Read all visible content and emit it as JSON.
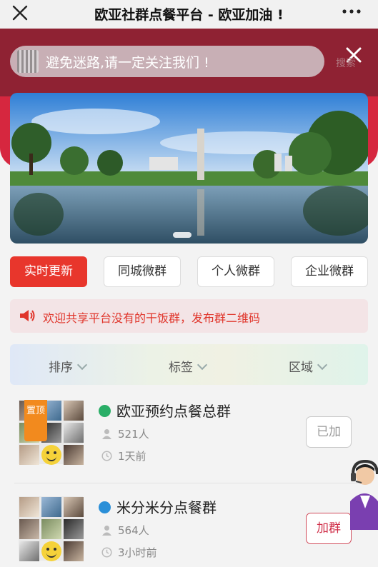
{
  "window": {
    "title": "欧亚社群点餐平台 - 欧亚加油 !"
  },
  "banner": {
    "follow_text": "避免迷路,请一定关注我们 !",
    "search_label": "搜索"
  },
  "tabs": [
    {
      "label": "实时更新",
      "active": true
    },
    {
      "label": "同城微群",
      "active": false
    },
    {
      "label": "个人微群",
      "active": false
    },
    {
      "label": "企业微群",
      "active": false
    }
  ],
  "notice": {
    "text": "欢迎共享平台没有的干饭群，发布群二维码"
  },
  "filters": [
    {
      "label": "排序"
    },
    {
      "label": "标签"
    },
    {
      "label": "区域"
    }
  ],
  "groups": [
    {
      "name": "欧亚预约点餐总群",
      "pin_label": "置顶",
      "members": "521人",
      "time": "1天前",
      "button": "已加",
      "platform_color": "#2aae67"
    },
    {
      "name": "米分米分点餐群",
      "members": "564人",
      "time": "3小时前",
      "button": "加群",
      "platform_color": "#2a8fd8"
    }
  ],
  "colors": {
    "accent_red": "#e8362c",
    "banner_red": "#d6273f",
    "pin_orange": "#f28a1e"
  }
}
